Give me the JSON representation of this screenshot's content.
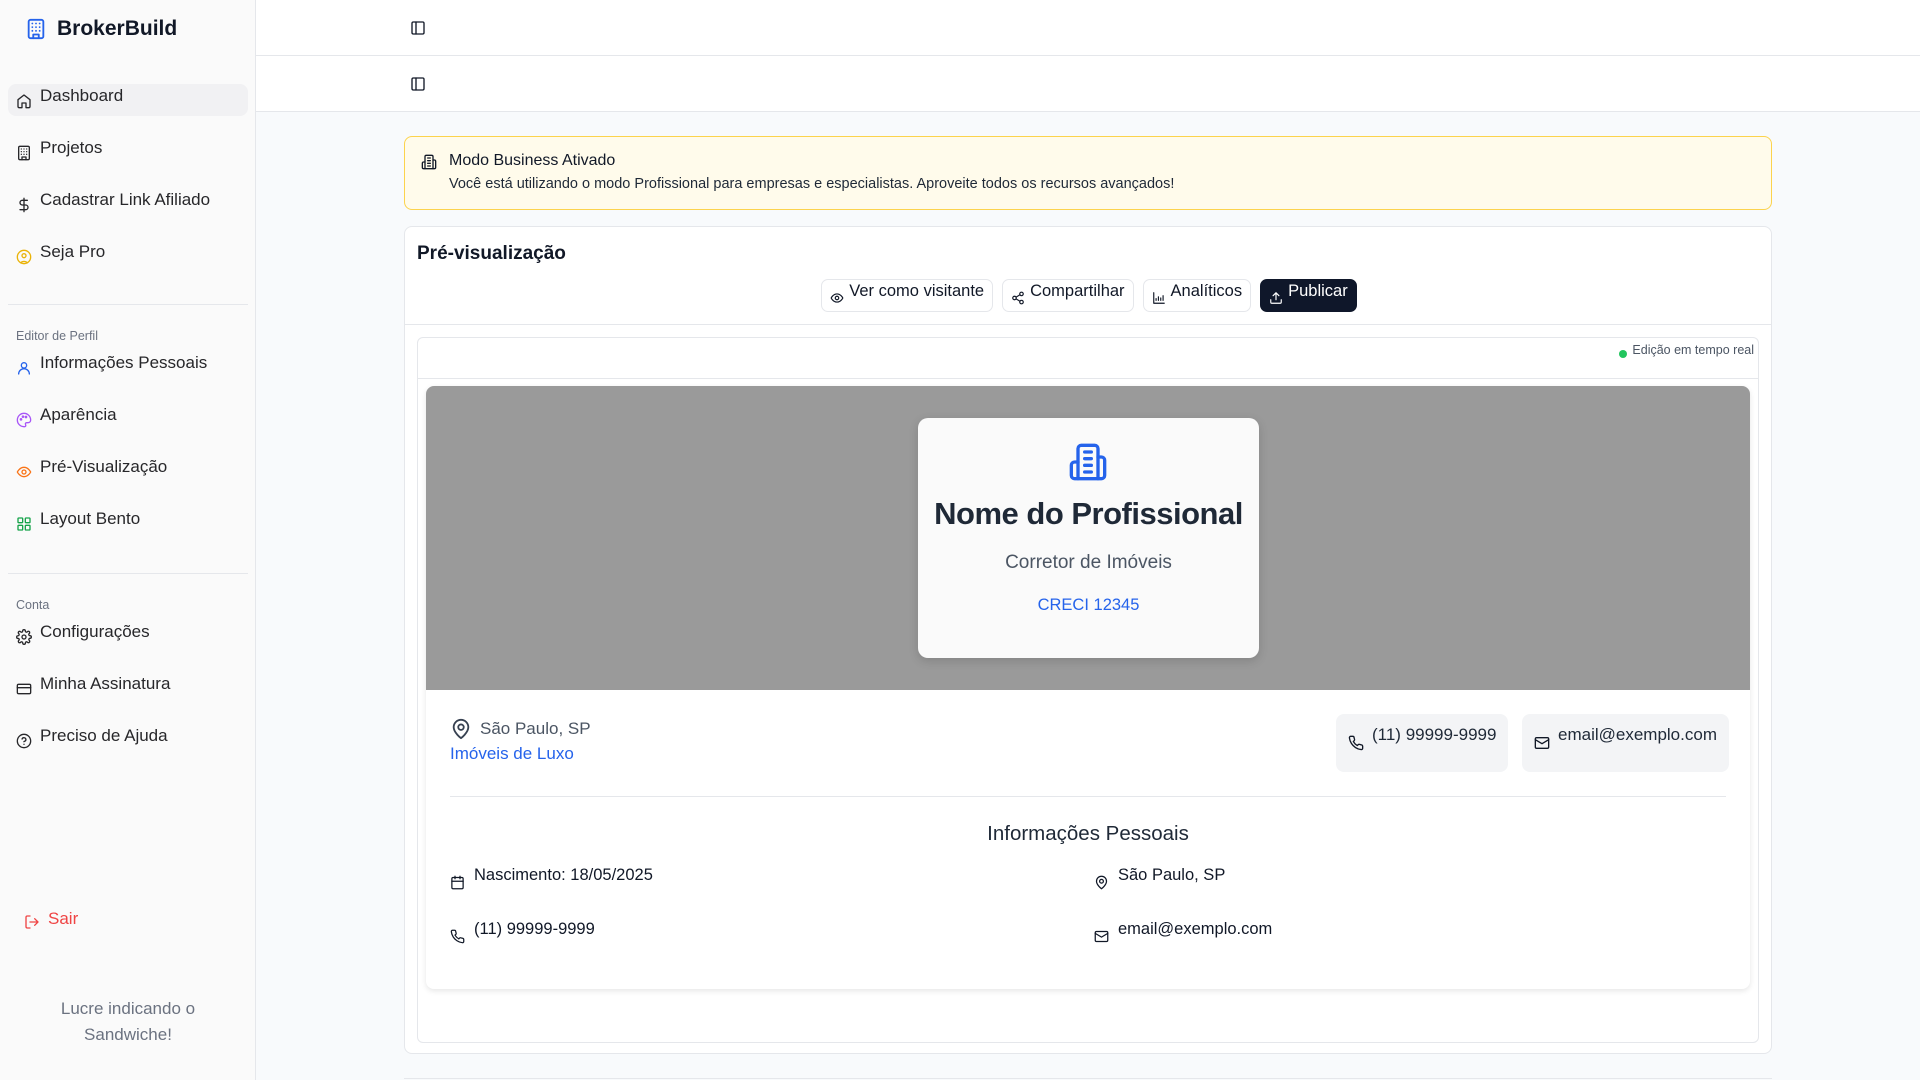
{
  "sidebar": {
    "brand": "BrokerBuild",
    "main_items": [
      {
        "label": "Dashboard",
        "icon": "home-icon",
        "active": true
      },
      {
        "label": "Projetos",
        "icon": "building-icon"
      },
      {
        "label": "Cadastrar Link Afiliado",
        "icon": "dollar-icon"
      },
      {
        "label": "Seja Pro",
        "icon": "badge-icon"
      }
    ],
    "profile_section": "Editor de Perfil",
    "profile_items": [
      {
        "label": "Informações Pessoais",
        "icon": "user-icon"
      },
      {
        "label": "Aparência",
        "icon": "palette-icon"
      },
      {
        "label": "Pré-Visualização",
        "icon": "eye-icon"
      },
      {
        "label": "Layout Bento",
        "icon": "grid-icon"
      }
    ],
    "account_section": "Conta",
    "account_items": [
      {
        "label": "Configurações",
        "icon": "gear-icon"
      },
      {
        "label": "Minha Assinatura",
        "icon": "credit-card-icon"
      },
      {
        "label": "Preciso de Ajuda",
        "icon": "help-circle-icon"
      }
    ],
    "logout": "Sair",
    "promo": "Lucre indicando o Sandwiche!"
  },
  "alert": {
    "title": "Modo Business Ativado",
    "description": "Você está utilizando o modo Profissional para empresas e especialistas. Aproveite todos os recursos avançados!"
  },
  "preview": {
    "title": "Pré-visualização",
    "actions": {
      "view_as_visitor": "Ver como visitante",
      "share": "Compartilhar",
      "analytics": "Analíticos",
      "publish": "Publicar"
    },
    "live_label": "Edição em tempo real"
  },
  "profile": {
    "name": "Nome do Profissional",
    "role": "Corretor de Imóveis",
    "creci": "CRECI 12345",
    "location": "São Paulo, SP",
    "specialty": "Imóveis de Luxo",
    "phone": "(11) 99999-9999",
    "email": "email@exemplo.com",
    "info_title": "Informações Pessoais",
    "birth": "Nascimento: 18/05/2025",
    "info_location": "São Paulo, SP",
    "info_phone": "(11) 99999-9999",
    "info_email": "email@exemplo.com"
  },
  "colors": {
    "accent": "#2563eb",
    "primary_button": "#0f172a",
    "alert_bg": "#fffbeb",
    "alert_border": "#fcd34d",
    "hero_bg": "#9a9a9a",
    "live_dot": "#22c55e",
    "logout": "#ef4444"
  }
}
